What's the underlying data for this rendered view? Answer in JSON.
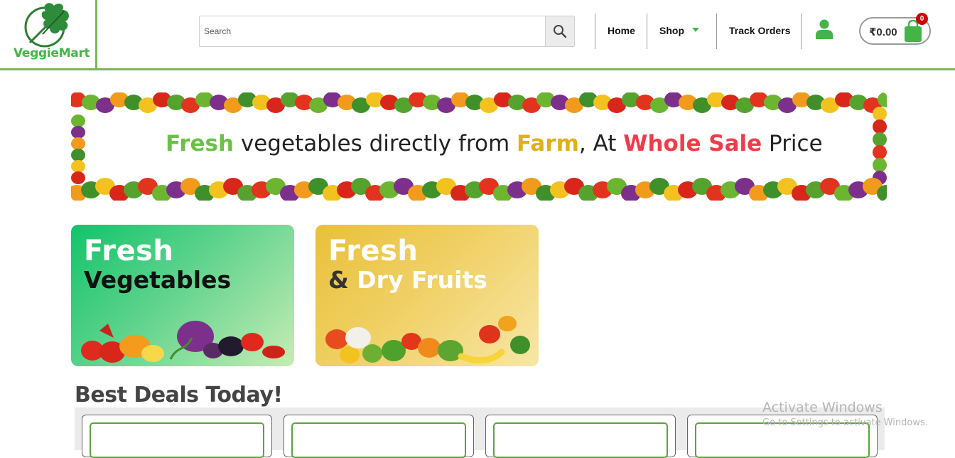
{
  "brand": {
    "name": "VeggieMart",
    "logo_icon": "spinach-leaf-icon"
  },
  "search": {
    "placeholder": "Search",
    "value": ""
  },
  "nav": {
    "home": "Home",
    "shop": "Shop",
    "track_orders": "Track Orders"
  },
  "cart": {
    "total": "₹0.00",
    "count": "0"
  },
  "banner": {
    "word_fresh": "Fresh",
    "middle": " vegetables directly from ",
    "word_farm": "Farm",
    "comma_at": ", At ",
    "word_whole_sale": "Whole Sale",
    "word_price": " Price"
  },
  "categories": [
    {
      "title": "Fresh",
      "subtitle": "Vegetables"
    },
    {
      "title": "Fresh",
      "amp": "& ",
      "subtitle": "Dry Fruits"
    }
  ],
  "deals": {
    "heading": "Best Deals Today!"
  },
  "system": {
    "activate_title": "Activate Windows",
    "activate_hint": "Go to Settings to activate Windows."
  },
  "colors": {
    "brand_green": "#43b548",
    "border_green": "#7cb45a",
    "badge_red": "#d00000"
  }
}
